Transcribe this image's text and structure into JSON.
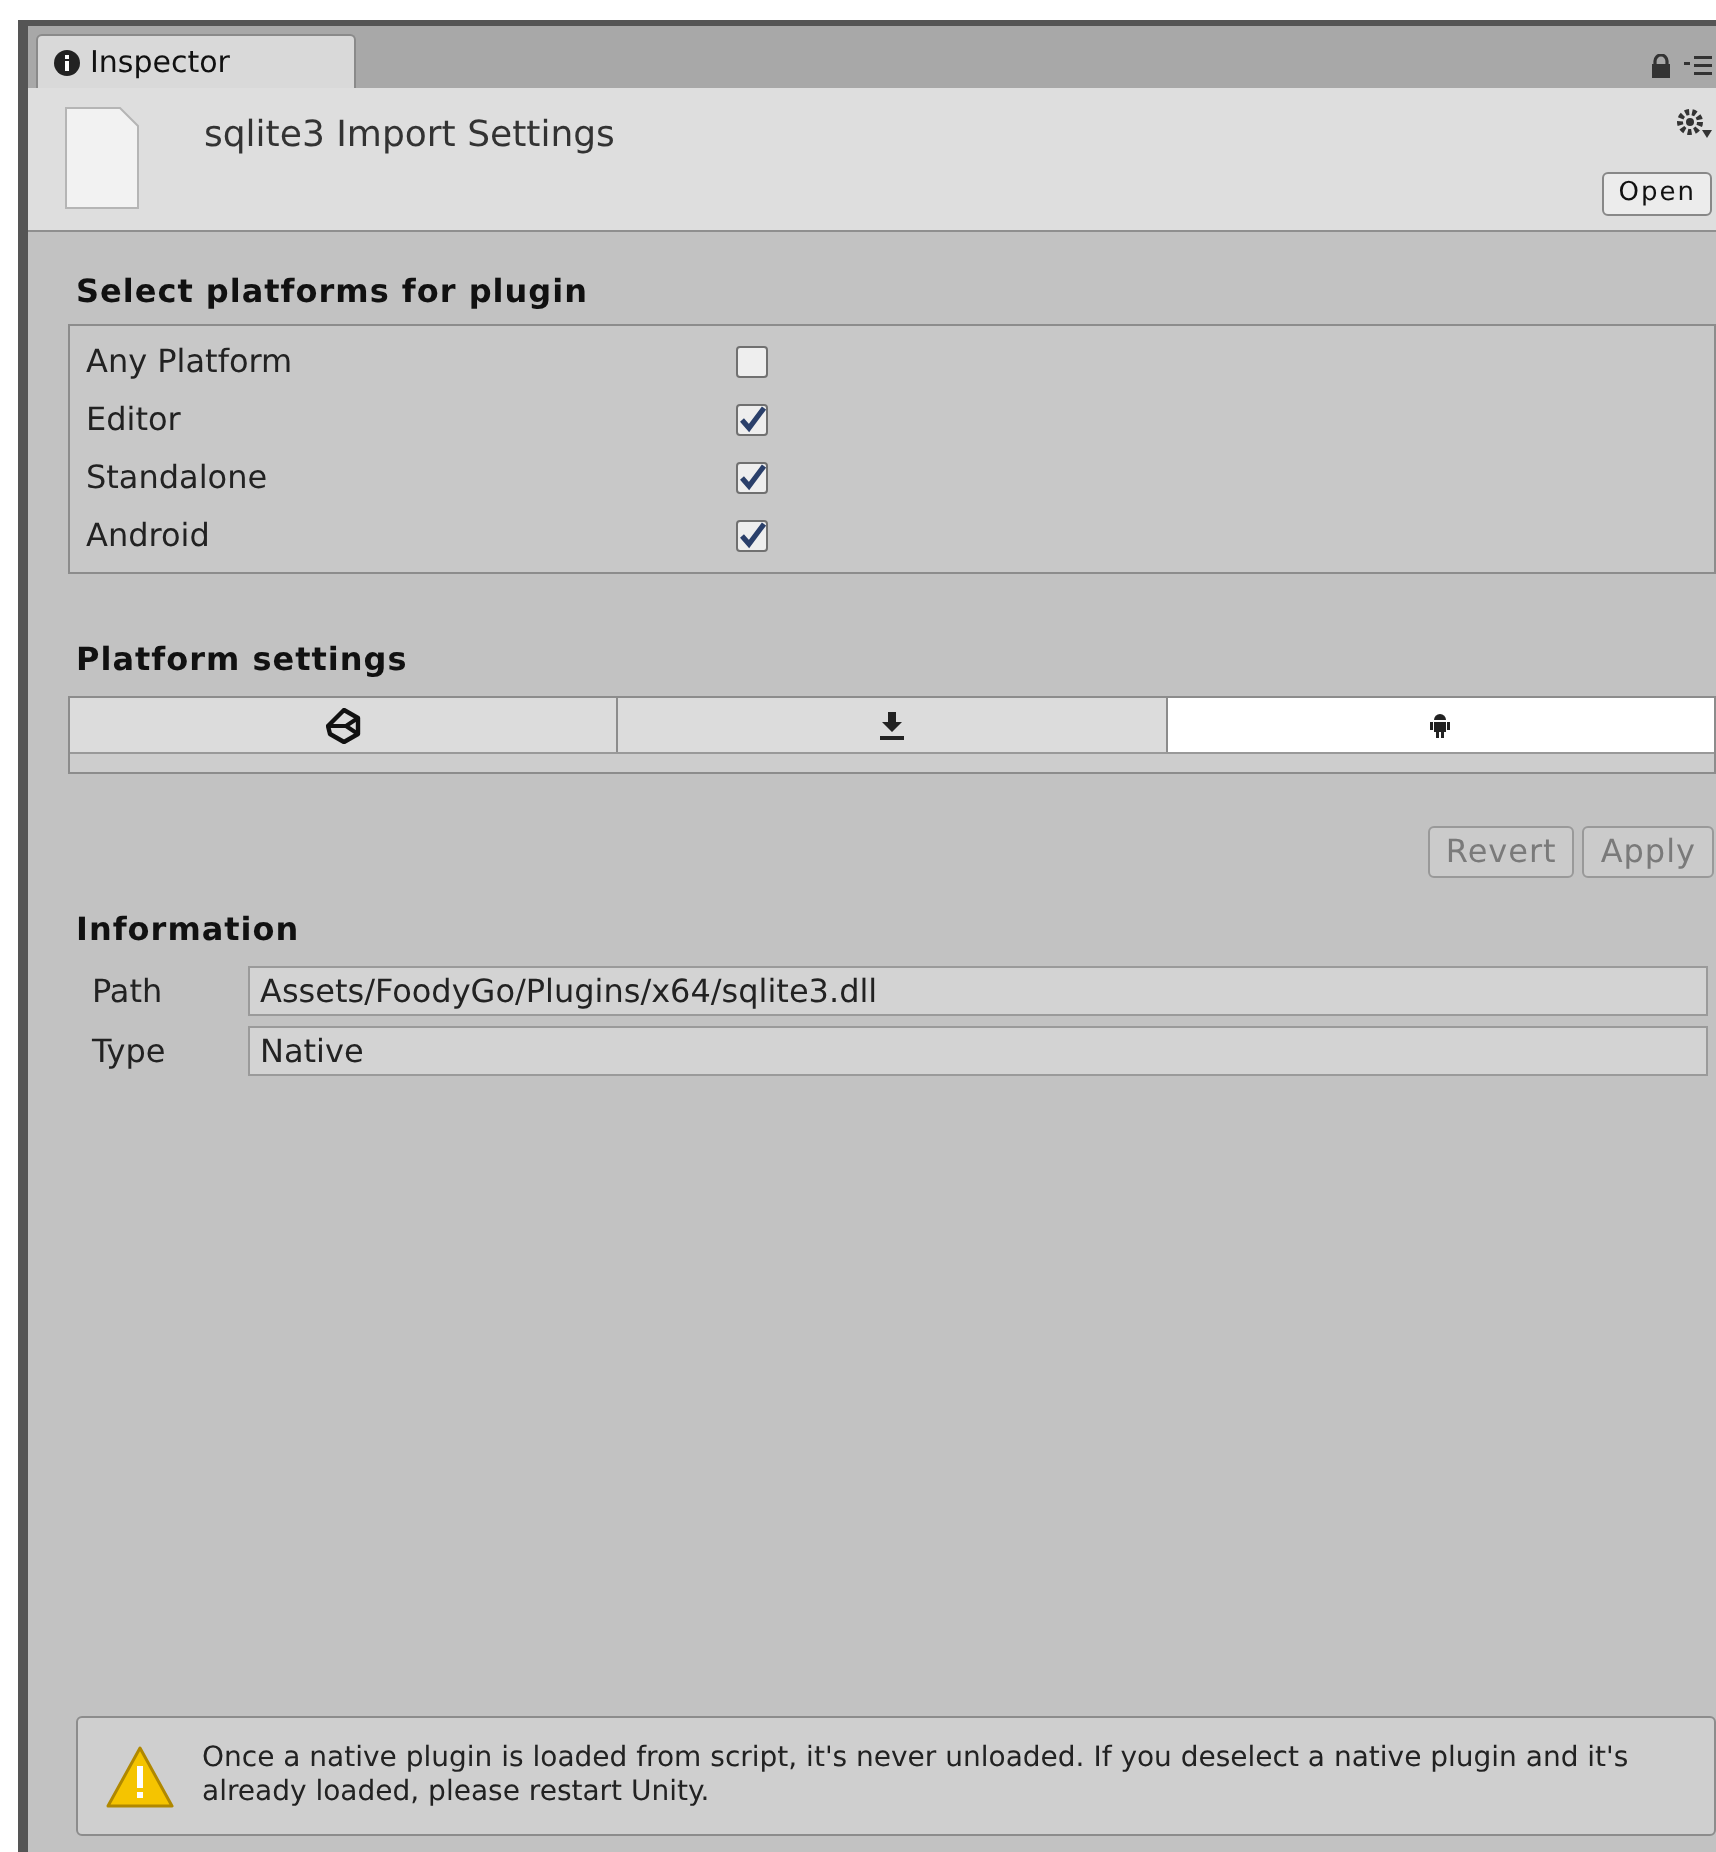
{
  "window": {
    "tab": "Inspector"
  },
  "header": {
    "title": "sqlite3 Import Settings",
    "open_button": "Open"
  },
  "platforms": {
    "heading": "Select platforms for plugin",
    "items": [
      {
        "label": "Any Platform",
        "checked": false
      },
      {
        "label": "Editor",
        "checked": true
      },
      {
        "label": "Standalone",
        "checked": true
      },
      {
        "label": "Android",
        "checked": true
      }
    ]
  },
  "platform_settings": {
    "heading": "Platform settings",
    "tabs": [
      {
        "kind": "editor",
        "selected": false
      },
      {
        "kind": "standalone",
        "selected": false
      },
      {
        "kind": "android",
        "selected": true
      }
    ]
  },
  "buttons": [
    {
      "label": "Revert",
      "disabled": true
    },
    {
      "label": "Apply",
      "disabled": true
    }
  ],
  "information": {
    "heading": "Information",
    "fields": [
      {
        "label": "Path",
        "value": "Assets/FoodyGo/Plugins/x64/sqlite3.dll"
      },
      {
        "label": "Type",
        "value": "Native"
      }
    ]
  },
  "warning": "Once a native plugin is loaded from script, it's never unloaded. If you deselect a native plugin and it's already loaded, please restart Unity."
}
